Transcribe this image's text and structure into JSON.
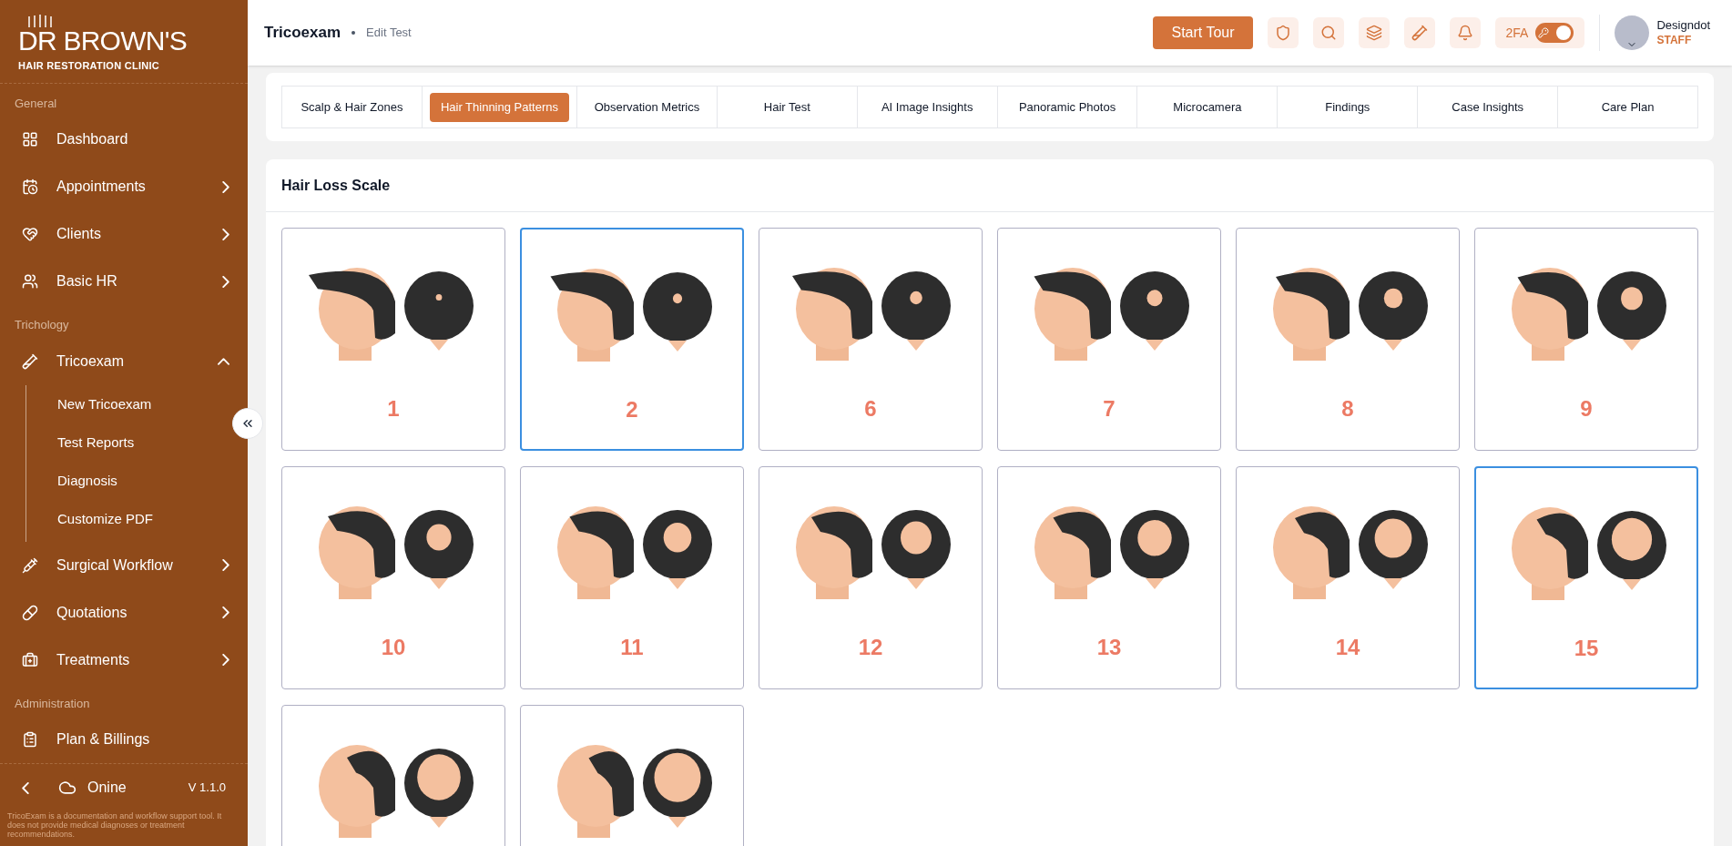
{
  "sidebar": {
    "logo": {
      "title": "DR BROWN'S",
      "subtitle": "HAIR RESTORATION CLINIC"
    },
    "sections": [
      {
        "title": "General",
        "items": [
          {
            "kind": "dashboard",
            "label": "Dashboard"
          },
          {
            "kind": "appointments",
            "label": "Appointments",
            "expanded": false
          },
          {
            "kind": "clients",
            "label": "Clients",
            "expanded": false
          },
          {
            "kind": "hr",
            "label": "Basic HR",
            "expanded": false
          }
        ]
      },
      {
        "title": "Trichology",
        "items": [
          {
            "kind": "exam",
            "label": "Tricoexam",
            "expanded": true,
            "children": [
              {
                "label": "New Tricoexam"
              },
              {
                "label": "Test Reports"
              },
              {
                "label": "Diagnosis"
              },
              {
                "label": "Customize PDF"
              }
            ]
          },
          {
            "kind": "surgical",
            "label": "Surgical Workflow",
            "expanded": false
          },
          {
            "kind": "quotations",
            "label": "Quotations",
            "expanded": false
          },
          {
            "kind": "treatments",
            "label": "Treatments",
            "expanded": false
          }
        ]
      },
      {
        "title": "Administration",
        "items": [
          {
            "kind": "billing",
            "label": "Plan & Billings"
          }
        ]
      }
    ],
    "footer": {
      "status": "Onine",
      "version": "V 1.1.0",
      "disclaimer": "TricoExam is a documentation and workflow support tool. It does not provide medical diagnoses or treatment recommendations."
    }
  },
  "header": {
    "title": "Tricoexam",
    "breadcrumb": "Edit Test",
    "tour_button": "Start Tour",
    "twofa": {
      "label": "2FA",
      "on": true
    },
    "user": {
      "name": "Designdot",
      "role": "STAFF"
    }
  },
  "tabs": [
    {
      "label": "Scalp & Hair Zones",
      "selected": false
    },
    {
      "label": "Hair Thinning Patterns",
      "selected": true
    },
    {
      "label": "Observation Metrics",
      "selected": false
    },
    {
      "label": "Hair Test",
      "selected": false
    },
    {
      "label": "AI Image Insights",
      "selected": false
    },
    {
      "label": "Panoramic Photos",
      "selected": false
    },
    {
      "label": "Microcamera",
      "selected": false
    },
    {
      "label": "Findings",
      "selected": false
    },
    {
      "label": "Case Insights",
      "selected": false
    },
    {
      "label": "Care Plan",
      "selected": false
    }
  ],
  "scale": {
    "title": "Hair Loss Scale",
    "cards": [
      {
        "label": "1",
        "selected": false
      },
      {
        "label": "2",
        "selected": true
      },
      {
        "label": "6",
        "selected": false
      },
      {
        "label": "7",
        "selected": false
      },
      {
        "label": "8",
        "selected": false
      },
      {
        "label": "9",
        "selected": false
      },
      {
        "label": "10",
        "selected": false
      },
      {
        "label": "11",
        "selected": false
      },
      {
        "label": "12",
        "selected": false
      },
      {
        "label": "13",
        "selected": false
      },
      {
        "label": "14",
        "selected": false
      },
      {
        "label": "15",
        "selected": true
      },
      {
        "selected": false
      },
      {
        "selected": false
      }
    ]
  }
}
